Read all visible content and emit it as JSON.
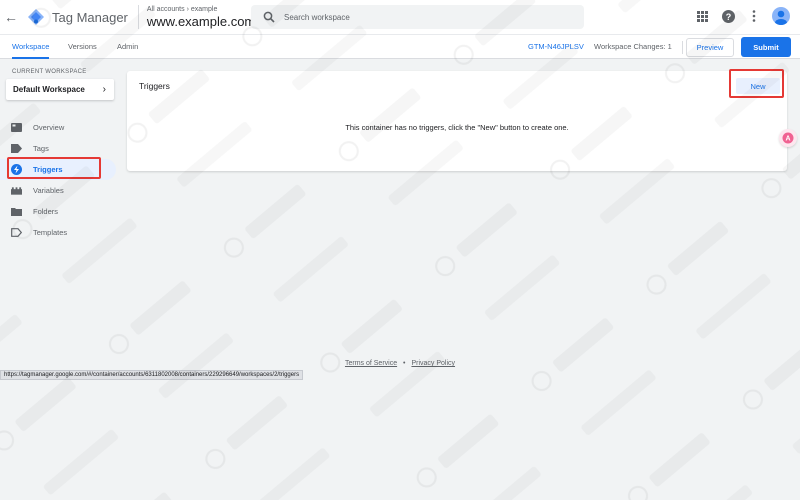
{
  "header": {
    "product_name": "Tag Manager",
    "breadcrumb": "All accounts",
    "breadcrumb_sep": "›",
    "breadcrumb_account": "example",
    "container_name": "www.example.com",
    "search_placeholder": "Search workspace"
  },
  "tabs": [
    {
      "label": "Workspace",
      "active": true
    },
    {
      "label": "Versions",
      "active": false
    },
    {
      "label": "Admin",
      "active": false
    }
  ],
  "toolbar": {
    "container_id": "GTM-N46JPLSV",
    "workspace_changes": "Workspace Changes: 1",
    "preview_label": "Preview",
    "submit_label": "Submit"
  },
  "sidebar": {
    "current_workspace_label": "CURRENT WORKSPACE",
    "workspace_name": "Default Workspace",
    "items": [
      {
        "label": "Overview",
        "icon": "overview-icon"
      },
      {
        "label": "Tags",
        "icon": "tag-icon"
      },
      {
        "label": "Triggers",
        "icon": "trigger-icon",
        "active": true
      },
      {
        "label": "Variables",
        "icon": "variables-icon"
      },
      {
        "label": "Folders",
        "icon": "folder-icon"
      },
      {
        "label": "Templates",
        "icon": "template-icon"
      }
    ]
  },
  "main": {
    "card_title": "Triggers",
    "new_label": "New",
    "empty_message": "This container has no triggers, click the \"New\" button to create one."
  },
  "footer": {
    "terms": "Terms of Service",
    "separator": "•",
    "privacy": "Privacy Policy"
  },
  "status_url": "https://tagmanager.google.com/#/container/accounts/6311802008/containers/229296649/workspaces/2/triggers",
  "colors": {
    "accent": "#1a73e8",
    "highlight": "#e53935",
    "background": "#f1f3f4"
  }
}
